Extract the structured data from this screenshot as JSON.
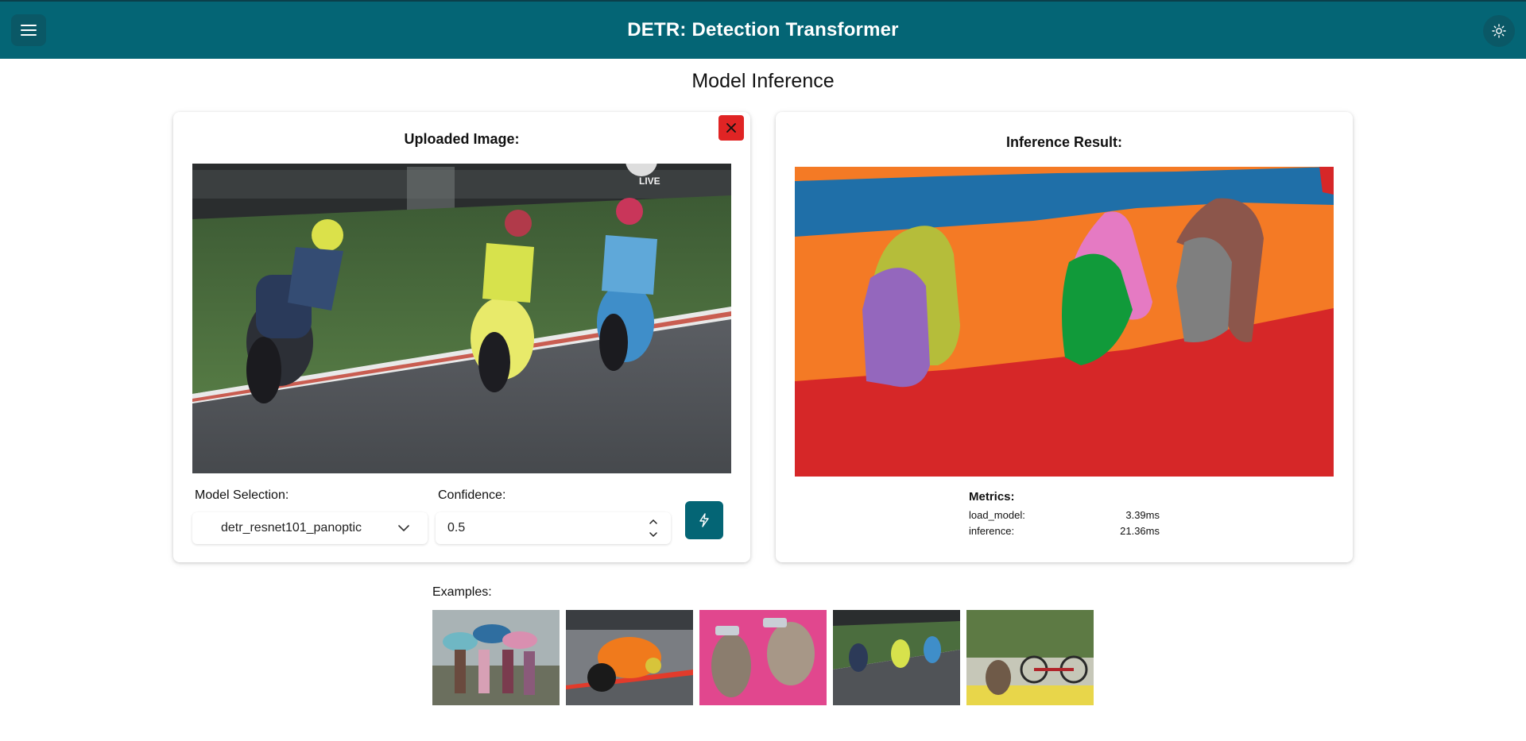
{
  "header": {
    "title": "DETR: Detection Transformer",
    "menu_icon": "hamburger-menu-icon",
    "theme_icon": "sun-icon"
  },
  "page": {
    "title": "Model Inference"
  },
  "upload_card": {
    "heading": "Uploaded Image:",
    "close_icon": "close-icon",
    "image_overlay_text": "LIVE",
    "model_label": "Model Selection:",
    "model_selected": "detr_resnet101_panoptic",
    "confidence_label": "Confidence:",
    "confidence_value": "0.5",
    "run_icon": "lightning-icon"
  },
  "result_card": {
    "heading": "Inference Result:",
    "metrics_title": "Metrics:",
    "metrics": [
      {
        "name": "load_model:",
        "value": "3.39ms"
      },
      {
        "name": "inference:",
        "value": "21.36ms"
      }
    ]
  },
  "examples": {
    "label": "Examples:"
  },
  "colors": {
    "brand": "#046575",
    "danger": "#e02424",
    "segment_blue": "#1f6fa8",
    "segment_orange": "#f47a25",
    "segment_red": "#d62728",
    "segment_olive": "#b5bd3a",
    "segment_purple": "#9467bd",
    "segment_pink": "#e57ac3",
    "segment_green": "#119a3a",
    "segment_brown": "#8c564b",
    "segment_gray": "#7f7f7f"
  }
}
